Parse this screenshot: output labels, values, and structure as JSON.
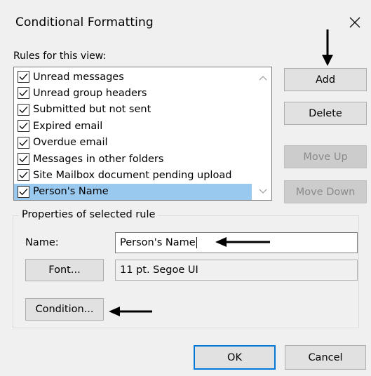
{
  "dialog": {
    "title": "Conditional Formatting",
    "close_icon": "close-icon"
  },
  "rules_label": "Rules for this view:",
  "rules": [
    {
      "label": "Unread messages",
      "checked": true,
      "selected": false
    },
    {
      "label": "Unread group headers",
      "checked": true,
      "selected": false
    },
    {
      "label": "Submitted but not sent",
      "checked": true,
      "selected": false
    },
    {
      "label": "Expired email",
      "checked": true,
      "selected": false
    },
    {
      "label": "Overdue email",
      "checked": true,
      "selected": false
    },
    {
      "label": "Messages in other folders",
      "checked": true,
      "selected": false
    },
    {
      "label": "Site Mailbox document pending upload",
      "checked": true,
      "selected": false
    },
    {
      "label": "Person's Name",
      "checked": true,
      "selected": true
    }
  ],
  "buttons": {
    "add": "Add",
    "delete": "Delete",
    "move_up": "Move Up",
    "move_down": "Move Down",
    "font": "Font...",
    "condition": "Condition...",
    "ok": "OK",
    "cancel": "Cancel"
  },
  "properties": {
    "legend": "Properties of selected rule",
    "name_label": "Name:",
    "name_value": "Person's Name",
    "font_value": "11 pt. Segoe UI"
  },
  "colors": {
    "selection": "#99c9ef",
    "focus_border": "#0078d7"
  }
}
